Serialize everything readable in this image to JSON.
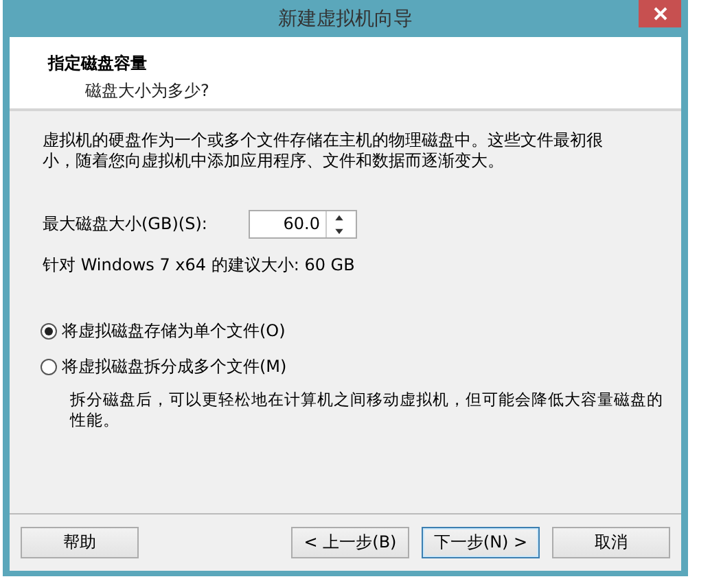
{
  "window": {
    "title": "新建虚拟机向导"
  },
  "header": {
    "title": "指定磁盘容量",
    "subtitle": "磁盘大小为多少?"
  },
  "description": "虚拟机的硬盘作为一个或多个文件存储在主机的物理磁盘中。这些文件最初很小，随着您向虚拟机中添加应用程序、文件和数据而逐渐变大。",
  "disk_size": {
    "label": "最大磁盘大小(GB)(S):",
    "value": "60.0"
  },
  "recommendation": "针对 Windows 7 x64 的建议大小: 60 GB",
  "options": [
    {
      "label": "将虚拟磁盘存储为单个文件(O)",
      "selected": true
    },
    {
      "label": "将虚拟磁盘拆分成多个文件(M)",
      "selected": false
    }
  ],
  "note": "拆分磁盘后，可以更轻松地在计算机之间移动虚拟机，但可能会降低大容量磁盘的性能。",
  "buttons": [
    {
      "label": "帮助",
      "default": false
    },
    {
      "label": "< 上一步(B)",
      "default": false
    },
    {
      "label": "下一步(N) >",
      "default": true
    },
    {
      "label": "取消",
      "default": false
    }
  ]
}
